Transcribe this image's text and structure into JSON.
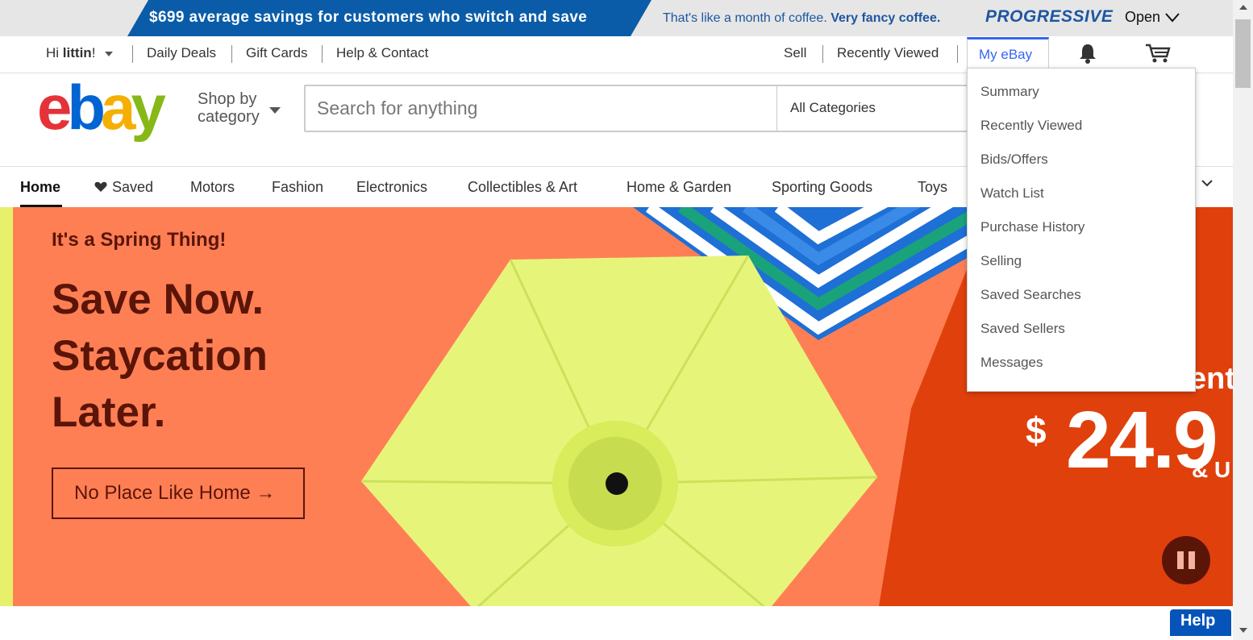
{
  "ad": {
    "headline": "$699 average savings for customers who switch and save",
    "tagline_plain": "That's like a month of coffee.",
    "tagline_bold": "Very fancy coffee.",
    "brand": "PROGRESSIVE",
    "open_label": "Open"
  },
  "topnav": {
    "greeting_prefix": "Hi",
    "username": "littin",
    "greeting_suffix": "!",
    "daily_deals": "Daily Deals",
    "gift_cards": "Gift Cards",
    "help_contact": "Help & Contact",
    "sell": "Sell",
    "recently_viewed": "Recently Viewed",
    "my_ebay": "My eBay",
    "notification_icon": "bell-icon",
    "cart_icon": "cart-icon"
  },
  "header": {
    "logo": {
      "e": "e",
      "b": "b",
      "a": "a",
      "y": "y"
    },
    "shop_by_line1": "Shop by",
    "shop_by_line2": "category",
    "search_placeholder": "Search for anything",
    "category_select": "All Categories"
  },
  "catnav": {
    "items": [
      "Home",
      "Saved",
      "Motors",
      "Fashion",
      "Electronics",
      "Collectibles & Art",
      "Home & Garden",
      "Sporting Goods",
      "Toys"
    ]
  },
  "hero": {
    "kicker": "It's a Spring Thing!",
    "headline": "Save Now.\nStaycation\nLater.",
    "cta": "No Place Like Home →",
    "partial_word": "ent",
    "price_symbol": "$",
    "price_digits": "24.9",
    "price_suffix": "& U"
  },
  "dropdown": {
    "items": [
      "Summary",
      "Recently Viewed",
      "Bids/Offers",
      "Watch List",
      "Purchase History",
      "Selling",
      "Saved Searches",
      "Saved Sellers",
      "Messages"
    ]
  },
  "help_button": "Help",
  "colors": {
    "ebay_red": "#e53238",
    "ebay_blue": "#0064d2",
    "ebay_yellow": "#f5af02",
    "ebay_green": "#86b817",
    "link_blue": "#3665f3",
    "hero_bg": "#ff7f55",
    "hero_text": "#5b1508"
  }
}
